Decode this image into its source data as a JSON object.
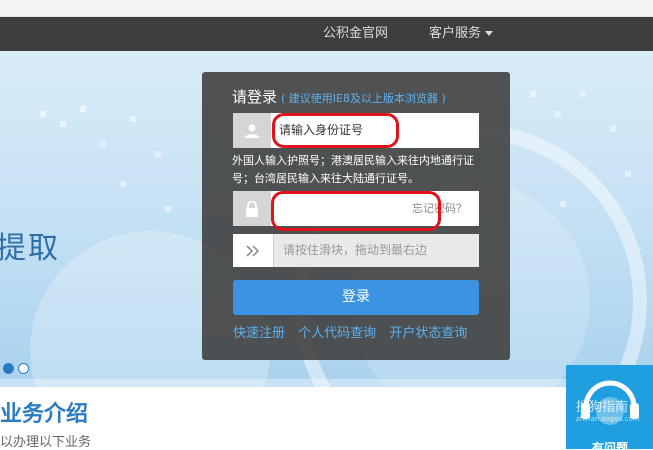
{
  "nav": {
    "items": [
      "公积金官网",
      "客户服务"
    ]
  },
  "banner": {
    "word": "提取"
  },
  "login": {
    "title": "请登录",
    "tip": "( 建议使用IE8及以上版本浏览器 )",
    "id_placeholder": "请输入身份证号",
    "id_hint": "外国人输入护照号；港澳居民输入来往内地通行证号；台湾居民输入来往大陆通行证号。",
    "forgot_password": "忘记密码？",
    "slider_text": "请按住滑块，拖动到最右边",
    "submit_label": "登录",
    "links": [
      "快速注册",
      "个人代码查询",
      "开户状态查询"
    ]
  },
  "section": {
    "title": "业务介绍",
    "subtitle": "以办理以下业务"
  },
  "watermark": {
    "text": "搜狗指南",
    "url": "zhinan.sogou.com",
    "bottom_text": "有问题"
  },
  "colors": {
    "accent": "#3c93e2",
    "link": "#5cb1ee",
    "nav_bg": "#3e3e3e",
    "annotation_red": "#e0121a"
  }
}
